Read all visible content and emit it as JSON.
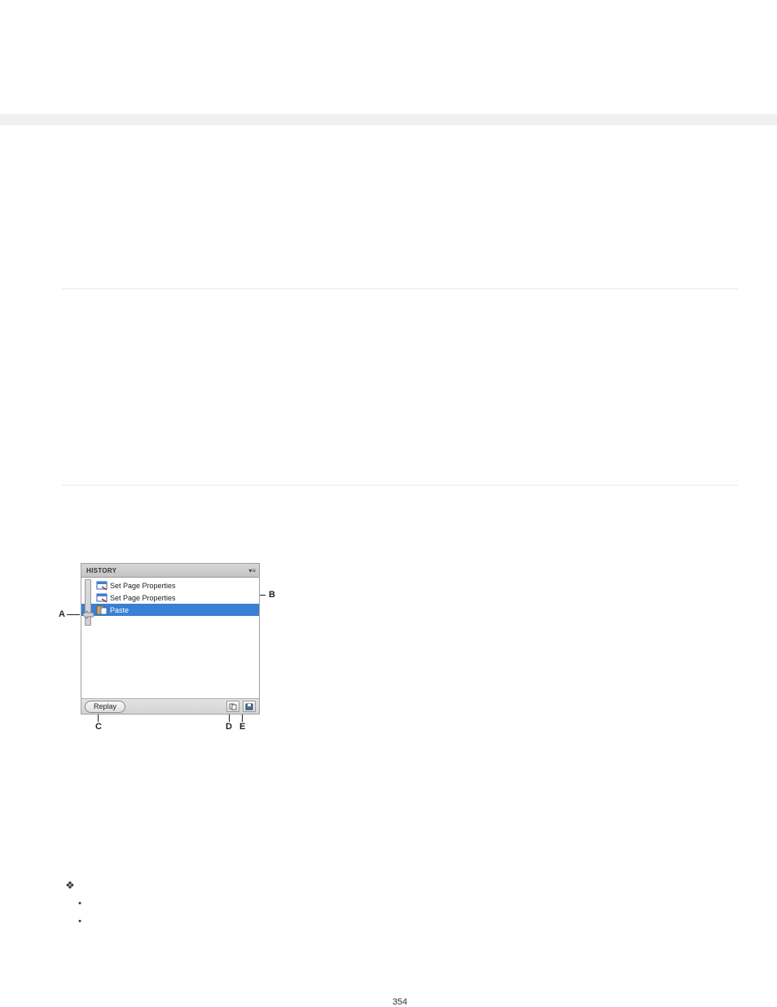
{
  "page_number": "354",
  "panel": {
    "title": "HISTORY",
    "rows": [
      {
        "label": "Set Page Properties"
      },
      {
        "label": "Set Page Properties"
      },
      {
        "label": "Paste"
      }
    ],
    "replay_label": "Replay"
  },
  "callouts": {
    "A": "A",
    "B": "B",
    "C": "C",
    "D": "D",
    "E": "E"
  }
}
